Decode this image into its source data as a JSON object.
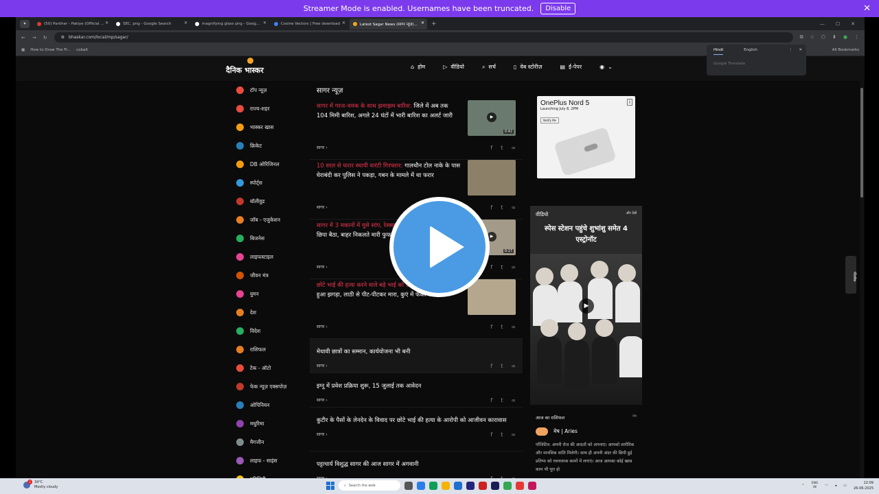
{
  "streamer": {
    "message": "Streamer Mode is enabled. Usernames have been truncated.",
    "disable_label": "Disable"
  },
  "tabs": [
    {
      "label": "(50) Panther - Pakiye (Official ...",
      "color": "#e53935"
    },
    {
      "label": "SEC. png - Google Search",
      "color": "#ffffff"
    },
    {
      "label": "magnifying glass png - Goog...",
      "color": "#ffffff"
    },
    {
      "label": "Cosine Vectors | Free download",
      "color": "#3b82f6"
    },
    {
      "label": "Latest Sagar News (सागर न्यूज़)...",
      "color": "#f5a623",
      "active": true
    }
  ],
  "address": {
    "url": "bhaskar.com/local/mp/sagar/"
  },
  "bookmarks": [
    "How to Draw The Fr...",
    "cobalt"
  ],
  "all_bookmarks": "All Bookmarks",
  "translate": {
    "lang1": "Hindi",
    "lang2": "English",
    "option": "Google Translate"
  },
  "site": {
    "logo": "दैनिक भास्कर",
    "nav": [
      "होम",
      "वीडियो",
      "सर्च",
      "वेब स्टोरीज़",
      "ई-पेपर"
    ]
  },
  "sidebar": [
    {
      "label": "टॉप न्यूज़",
      "color": "#e74c3c"
    },
    {
      "label": "राज्य-शहर",
      "color": "#e74c3c"
    },
    {
      "label": "भास्कर खास",
      "color": "#f39c12"
    },
    {
      "label": "क्रिकेट",
      "color": "#2980b9"
    },
    {
      "label": "DB ओरिजिनल",
      "color": "#f39c12"
    },
    {
      "label": "स्पोर्ट्स",
      "color": "#3498db"
    },
    {
      "label": "बॉलीवुड",
      "color": "#c0392b"
    },
    {
      "label": "जॉब - एजुकेशन",
      "color": "#e67e22"
    },
    {
      "label": "बिजनेस",
      "color": "#27ae60"
    },
    {
      "label": "लाइफस्टाइल",
      "color": "#e84393"
    },
    {
      "label": "जीवन मंत्र",
      "color": "#d35400"
    },
    {
      "label": "वुमन",
      "color": "#e84393"
    },
    {
      "label": "देश",
      "color": "#e67e22"
    },
    {
      "label": "विदेश",
      "color": "#27ae60"
    },
    {
      "label": "राशिफल",
      "color": "#e67e22"
    },
    {
      "label": "टेक - ऑटो",
      "color": "#e74c3c"
    },
    {
      "label": "फेक न्यूज़ एक्सपोज़",
      "color": "#c0392b"
    },
    {
      "label": "ओपिनियन",
      "color": "#2980b9"
    },
    {
      "label": "मधुरिमा",
      "color": "#8e44ad"
    },
    {
      "label": "मैगजीन",
      "color": "#7f8c8d"
    },
    {
      "label": "लाइफ - साइंस",
      "color": "#9b59b6"
    },
    {
      "label": "यूटिलिटी",
      "color": "#f1c40f"
    }
  ],
  "feed": {
    "title": "सागर न्यूज़",
    "stories": [
      {
        "red": "सागर में गरज-चमक के साथ झमाझम बारिश:",
        "text": " जिले में अब तक 104 मिमी बारिश, अगले 24 घंटों में भारी बारिश का अलर्ट जारी",
        "tag": "सागर",
        "duration": "0:42",
        "thumb": "#6b7a6e"
      },
      {
        "red": "10 साल से फरार स्थायी वारंटी गिरफ्तार:",
        "text": " गालथौन टोल नाके के पास घेराबंदी कर पुलिस ने पकड़ा, गबन के मामले में था फरार",
        "tag": "सागर",
        "duration": "",
        "thumb": "#8d8068"
      },
      {
        "red": "सागर में 3 मकानों में घुसे सांप, रेस्क्यू:",
        "text": " कोबरा और सिंक के पीछे छिपा बैठा, बाहर निकलते मारी फुफकार",
        "tag": "सागर",
        "duration": "0:17",
        "thumb": "#a39a89"
      },
      {
        "red": "छोटे भाई की हत्या करने वाले बड़े भाई को उम्रकैद:",
        "text": " पैसों को लेकर हुआ झगड़ा, लाठी से पीट-पीटकर मारा, कुएं में फेंका शव",
        "tag": "सागर",
        "duration": "",
        "thumb": "#b5a78e"
      }
    ],
    "small_stories": [
      {
        "text": "मेधावी छात्रों का सम्मान, कार्ययोजना भी बनी",
        "tag": "सागर"
      },
      {
        "text": "इग्नू में प्रवेश प्रक्रिया शुरू, 15 जुलाई तक आवेदन",
        "tag": "सागर"
      },
      {
        "text": "कुटीर के पैसों के लेनदेन के विवाद पर छोटे भाई की हत्या के आरोपी को आजीवन कारावास",
        "tag": "सागर"
      },
      {
        "text": "पट्टाचार्य विशुद्ध सागर की आज सागर में अगवानी",
        "tag": "सागर"
      }
    ]
  },
  "ad": {
    "title": "OnePlus Nord 5",
    "sub": "Launching July 8, 2PM",
    "button": "Notify Me"
  },
  "video": {
    "header": "वीडियो",
    "all": "और देखें",
    "title": "स्पेस स्टेशन पहुंचे शुभांशु समेत 4 एस्ट्रोनॉट"
  },
  "horoscope": {
    "header": "आज का राशिफल",
    "lang": "मेष",
    "sign": "मेष | Aries",
    "text": "पॉजिटिव: अपनी रोज की आदतों को अपनाएं। आपको शारीरिक और मानसिक शांति मिलेगी। साथ ही अपनी अंदर की छिपी हुई प्रतिभा को रचनात्मक कामों में लगाएं। आज आपका कोई खास काम भी पूरा हो"
  },
  "feedback": "फीडबैक",
  "taskbar": {
    "temp": "34°C",
    "weather": "Mostly cloudy",
    "search": "Search the web",
    "lang": "ENG",
    "region": "IN",
    "time": "12:09",
    "date": "26-06-2025"
  }
}
